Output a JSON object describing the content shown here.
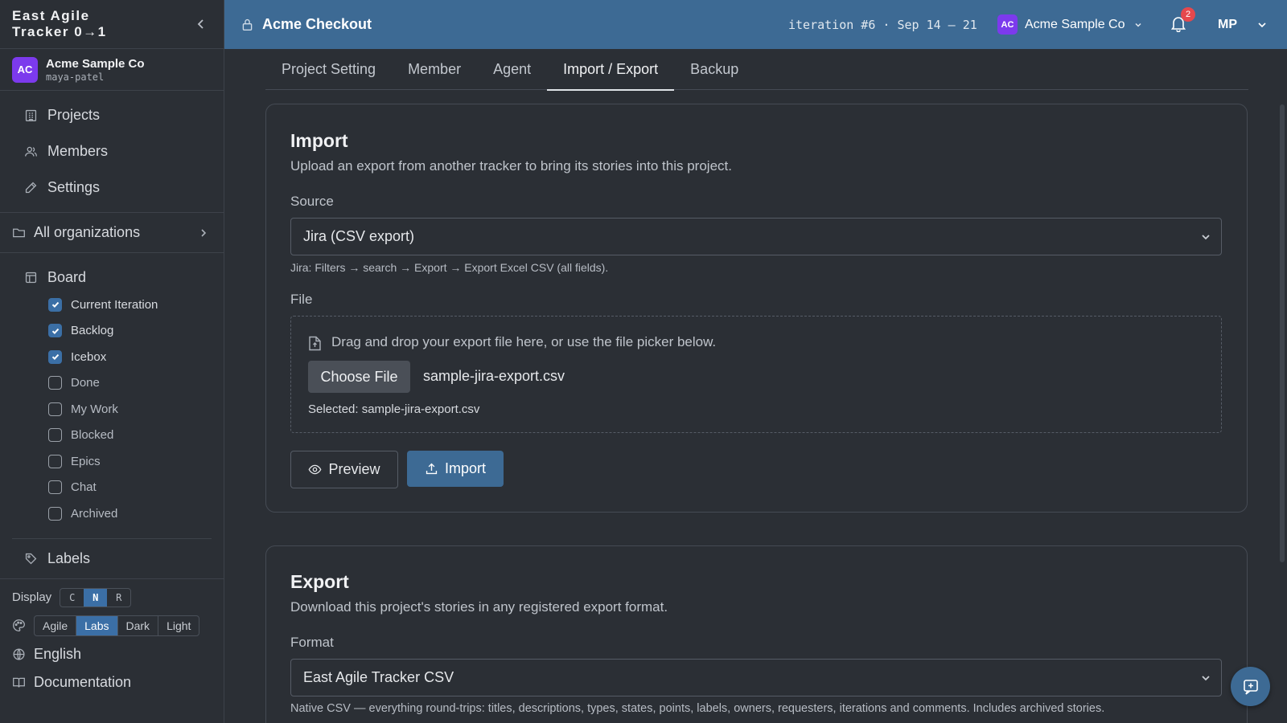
{
  "brand": {
    "line1": "East Agile",
    "line2": "Tracker 0→1"
  },
  "org": {
    "initials": "AC",
    "name": "Acme Sample Co",
    "user": "maya-patel"
  },
  "nav": [
    {
      "label": "Projects",
      "icon": "building-icon"
    },
    {
      "label": "Members",
      "icon": "users-icon"
    },
    {
      "label": "Settings",
      "icon": "pencil-icon"
    }
  ],
  "all_orgs": "All organizations",
  "board": {
    "title": "Board",
    "items": [
      {
        "label": "Current Iteration",
        "checked": true
      },
      {
        "label": "Backlog",
        "checked": true
      },
      {
        "label": "Icebox",
        "checked": true
      },
      {
        "label": "Done",
        "checked": false
      },
      {
        "label": "My Work",
        "checked": false
      },
      {
        "label": "Blocked",
        "checked": false
      },
      {
        "label": "Epics",
        "checked": false
      },
      {
        "label": "Chat",
        "checked": false
      },
      {
        "label": "Archived",
        "checked": false
      }
    ]
  },
  "labels": "Labels",
  "display": {
    "label": "Display",
    "options": [
      "C",
      "N",
      "R"
    ],
    "selected": "N"
  },
  "theme": {
    "options": [
      "Agile",
      "Labs",
      "Dark",
      "Light"
    ],
    "selected": "Labs"
  },
  "language": "English",
  "documentation": "Documentation",
  "topbar": {
    "project": "Acme Checkout",
    "iteration": "iteration #6 · Sep 14 – 21",
    "org_initials": "AC",
    "org_name": "Acme Sample Co",
    "notifications": "2",
    "user_initials": "MP"
  },
  "tabs": [
    {
      "label": "Project Setting",
      "active": false
    },
    {
      "label": "Member",
      "active": false
    },
    {
      "label": "Agent",
      "active": false
    },
    {
      "label": "Import / Export",
      "active": true
    },
    {
      "label": "Backup",
      "active": false
    }
  ],
  "import": {
    "title": "Import",
    "description": "Upload an export from another tracker to bring its stories into this project.",
    "source_label": "Source",
    "source_value": "Jira (CSV export)",
    "source_hint": "Jira: Filters → search → Export → Export Excel CSV (all fields).",
    "file_label": "File",
    "dropzone_text": "Drag and drop your export file here, or use the file picker below.",
    "choose_file": "Choose File",
    "file_name": "sample-jira-export.csv",
    "selected_text": "Selected: sample-jira-export.csv",
    "preview_button": "Preview",
    "import_button": "Import"
  },
  "export": {
    "title": "Export",
    "description": "Download this project's stories in any registered export format.",
    "format_label": "Format",
    "format_value": "East Agile Tracker CSV",
    "format_hint": "Native CSV — everything round-trips: titles, descriptions, types, states, points, labels, owners, requesters, iterations and comments. Includes archived stories."
  },
  "colors": {
    "accent": "#3d6a94",
    "topbar": "#3d6a94",
    "background": "#2b2f35",
    "avatar": "#7c3aed",
    "badge": "#e5484d"
  }
}
